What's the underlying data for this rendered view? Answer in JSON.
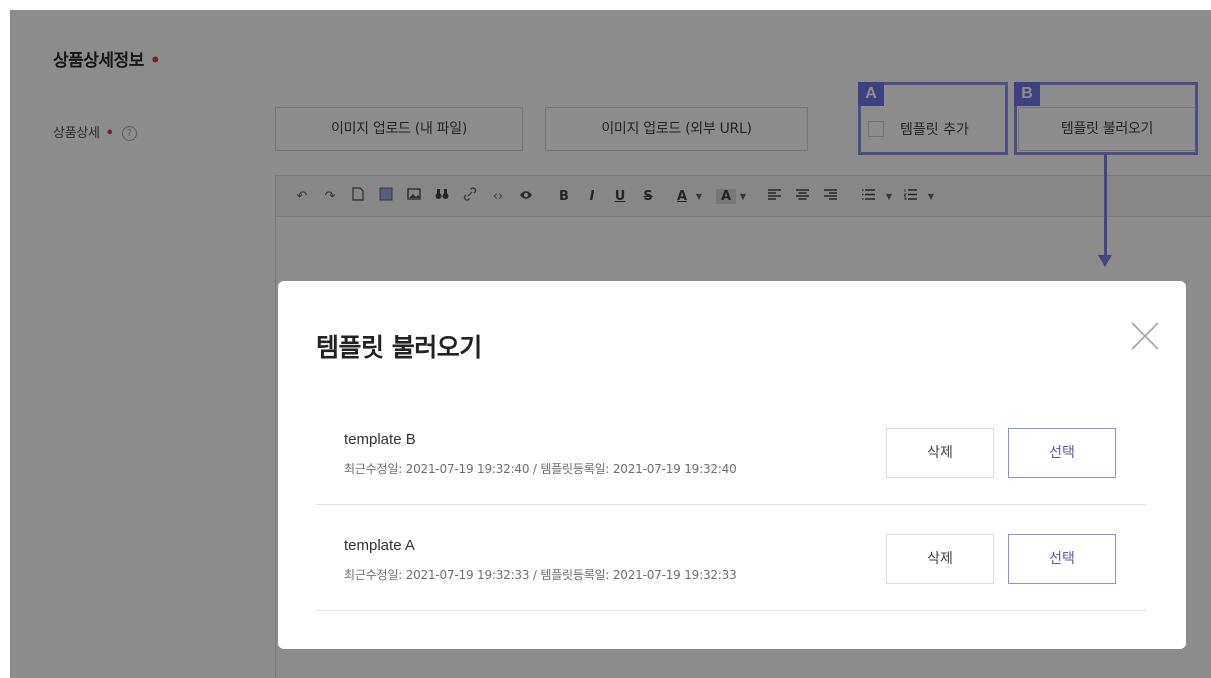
{
  "section": {
    "title": "상품상세정보",
    "required_mark": "•"
  },
  "field": {
    "label": "상품상세",
    "required_mark": "•",
    "help": "?"
  },
  "buttons": {
    "upload_mine": "이미지 업로드 (내 파일)",
    "upload_url": "이미지 업로드 (외부 URL)",
    "template_add": "템플릿 추가",
    "template_load": "템플릿 불러오기"
  },
  "annotations": {
    "a": "A",
    "b": "B",
    "color": "#7476e9"
  },
  "toolbar": {
    "items": [
      "undo-icon",
      "redo-icon",
      "new-document-icon",
      "image-folder-icon",
      "image-icon",
      "find-icon",
      "link-icon",
      "code-icon",
      "preview-icon",
      "bold",
      "italic",
      "underline",
      "strikethrough",
      "font-color",
      "background-color",
      "align-left-icon",
      "align-center-icon",
      "align-right-icon",
      "bullet-list-icon",
      "numbered-list-icon"
    ],
    "bold": "B",
    "italic": "I",
    "underline": "U",
    "strike": "S",
    "font_color": "A",
    "bg_color": "A"
  },
  "modal": {
    "title": "템플릿 불러오기",
    "close_icon": "close-icon",
    "templates": [
      {
        "name": "template B",
        "meta": "최근수정일: 2021-07-19 19:32:40 / 템플릿등록일: 2021-07-19 19:32:40",
        "delete_label": "삭제",
        "select_label": "선택"
      },
      {
        "name": "template A",
        "meta": "최근수정일: 2021-07-19 19:32:33 / 템플릿등록일: 2021-07-19 19:32:33",
        "delete_label": "삭제",
        "select_label": "선택"
      }
    ]
  }
}
